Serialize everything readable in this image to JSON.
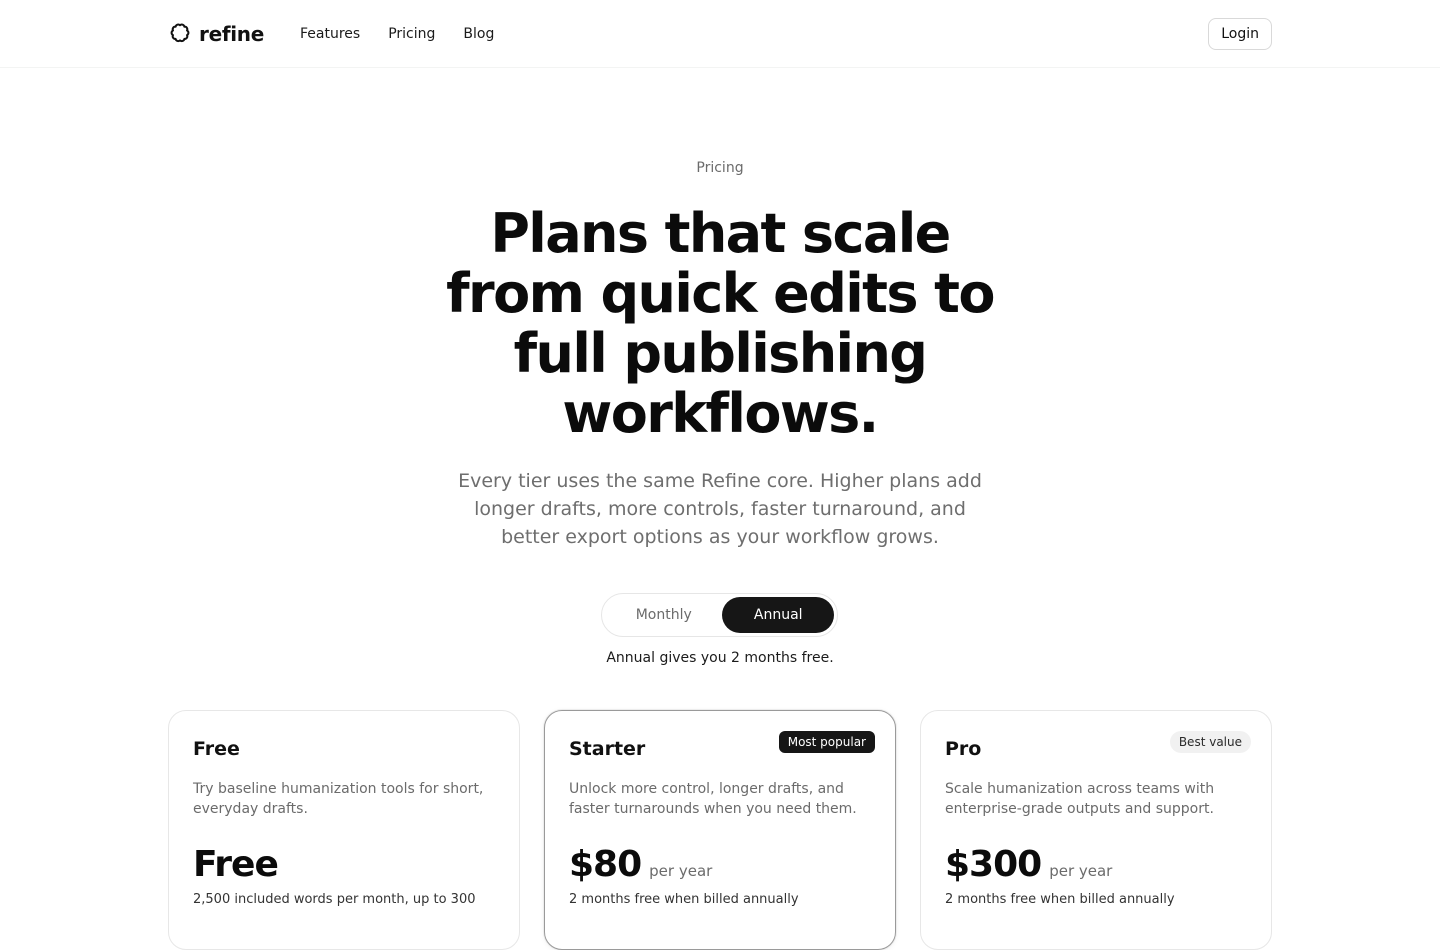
{
  "header": {
    "brand": "refine",
    "nav": [
      "Features",
      "Pricing",
      "Blog"
    ],
    "login_label": "Login"
  },
  "hero": {
    "eyebrow": "Pricing",
    "title": "Plans that scale from quick edits to full publishing workflows.",
    "subtitle": "Every tier uses the same Refine core. Higher plans add longer drafts, more controls, faster turnaround, and better export options as your workflow grows."
  },
  "billing_toggle": {
    "options": [
      "Monthly",
      "Annual"
    ],
    "selected": "Annual",
    "note": "Annual gives you 2 months free."
  },
  "plans": [
    {
      "name": "Free",
      "description": "Try baseline humanization tools for short, everyday drafts.",
      "price": "Free",
      "period": "",
      "note": "2,500 included words per month, up to 300",
      "badge": ""
    },
    {
      "name": "Starter",
      "description": "Unlock more control, longer drafts, and faster turnarounds when you need them.",
      "price": "$80",
      "period": "per year",
      "note": "2 months free when billed annually",
      "badge": "Most popular"
    },
    {
      "name": "Pro",
      "description": "Scale humanization across teams with enterprise-grade outputs and support.",
      "price": "$300",
      "period": "per year",
      "note": "2 months free when billed annually",
      "badge": "Best value"
    }
  ],
  "colors": {
    "accent_dark": "#161616",
    "muted_text": "#6b6b6b",
    "border": "#e7e7e7"
  }
}
